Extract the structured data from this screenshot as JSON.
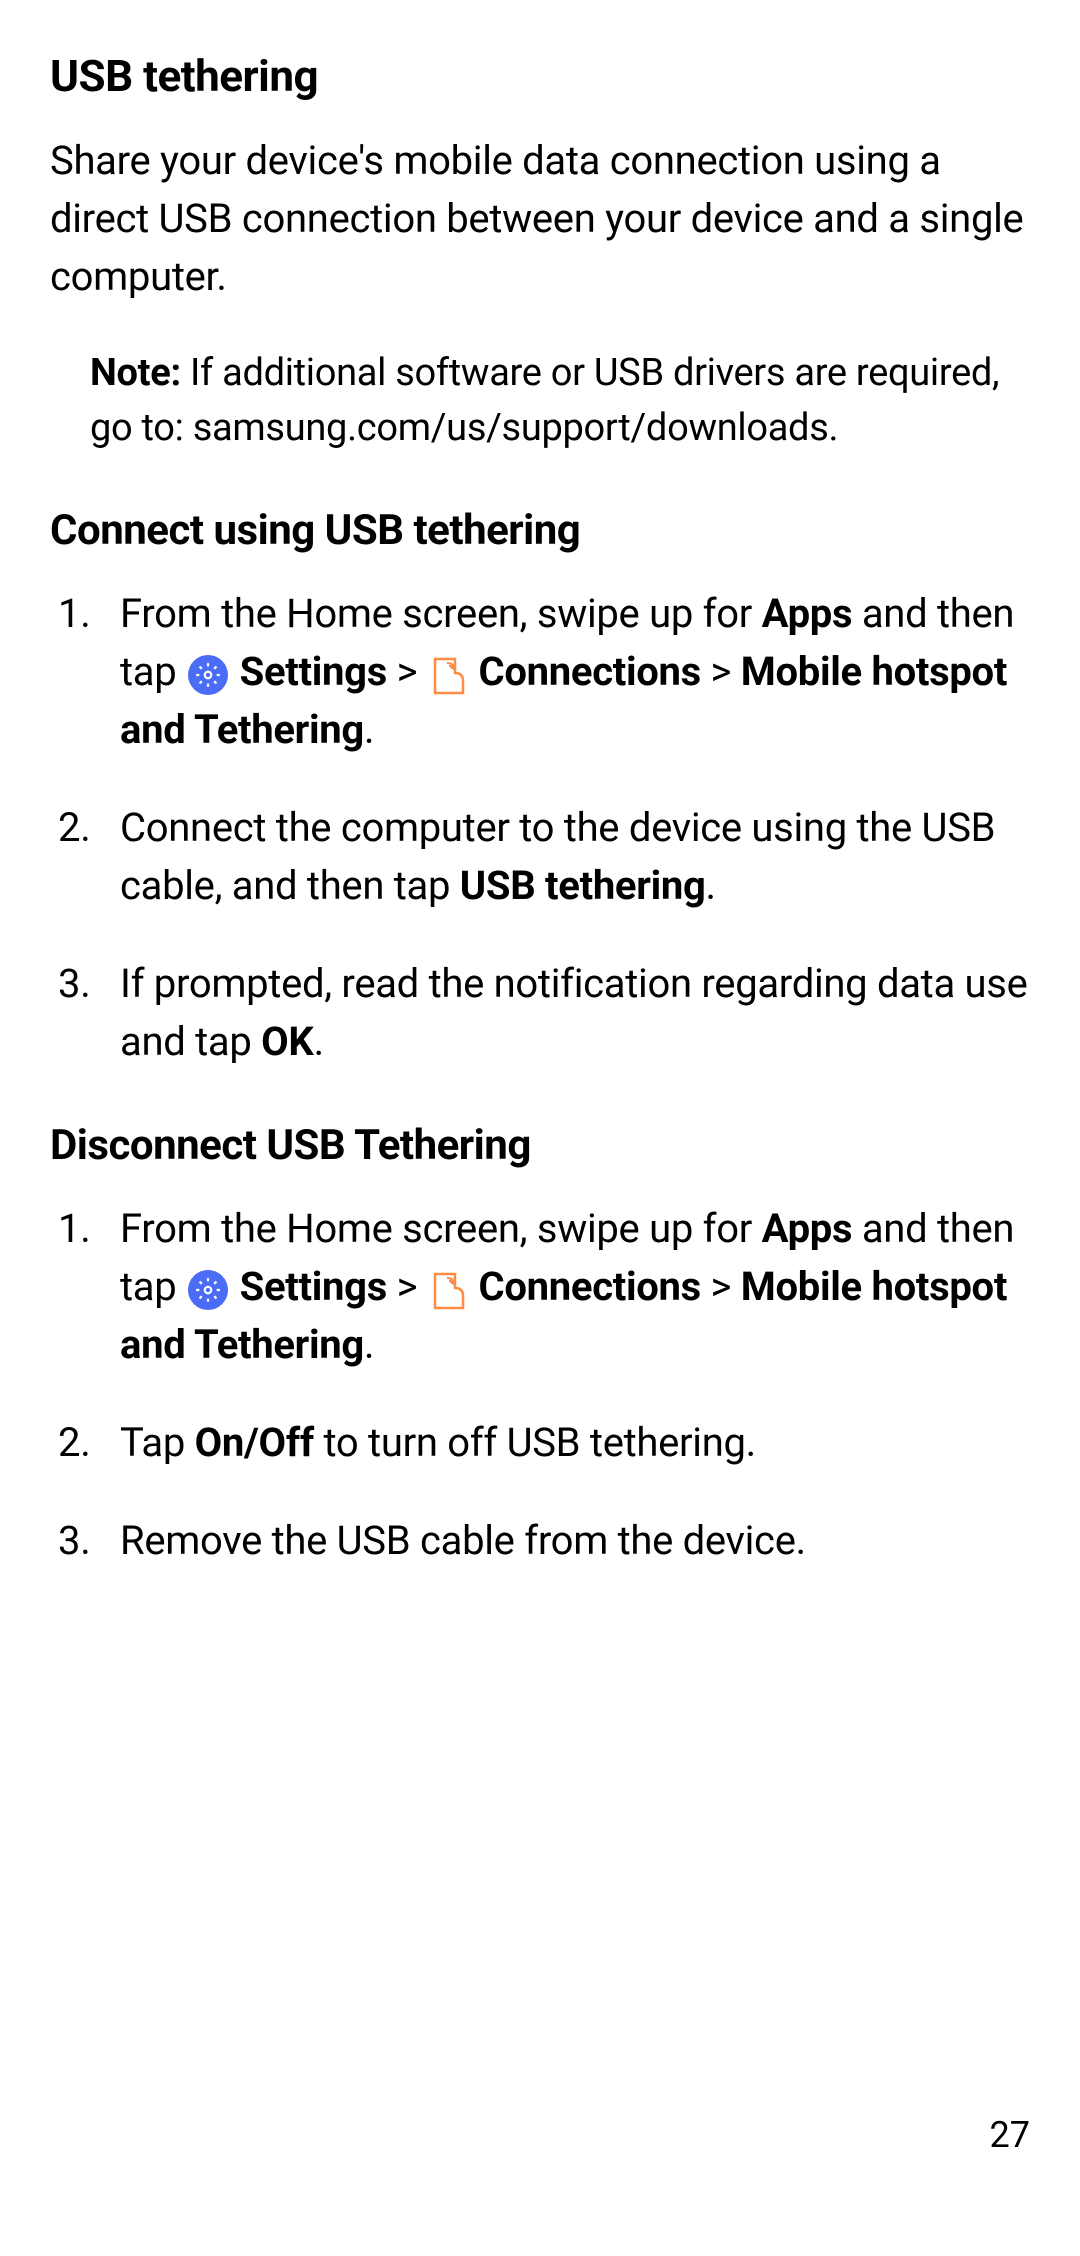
{
  "heading1": "USB tethering",
  "intro": "Share your device's mobile data connection using a direct USB connection between your device and a single computer.",
  "note": {
    "label": "Note: ",
    "text": "If additional software or USB drivers are required, go to: samsung.com/us/support/downloads."
  },
  "section_connect": {
    "heading": "Connect using USB tethering",
    "steps": {
      "s1_pre": "From the Home screen, swipe up for ",
      "s1_apps": "Apps",
      "s1_and_tap": " and then tap ",
      "s1_settings": " Settings",
      "s1_chev1": " > ",
      "s1_connections": " Connections",
      "s1_chev2": " > ",
      "s1_mobile": "Mobile hotspot and Tethering",
      "s1_period": ".",
      "s2_pre": "Connect the computer to the device using the USB cable, and then tap ",
      "s2_usb": "USB tethering",
      "s2_period": ".",
      "s3_pre": "If prompted, read the notification regarding data use and tap ",
      "s3_ok": "OK",
      "s3_period": "."
    }
  },
  "section_disconnect": {
    "heading": "Disconnect USB Tethering",
    "steps": {
      "s1_pre": "From the Home screen, swipe up for ",
      "s1_apps": "Apps",
      "s1_and_tap": " and then tap ",
      "s1_settings": " Settings",
      "s1_chev1": " > ",
      "s1_connections": " Connections",
      "s1_chev2": " > ",
      "s1_mobile": "Mobile hotspot and Tethering",
      "s1_period": ".",
      "s2_pre": "Tap ",
      "s2_onoff": "On/Off",
      "s2_post": " to turn off USB tethering.",
      "s3": "Remove the USB cable from the device."
    }
  },
  "page_number": "27"
}
